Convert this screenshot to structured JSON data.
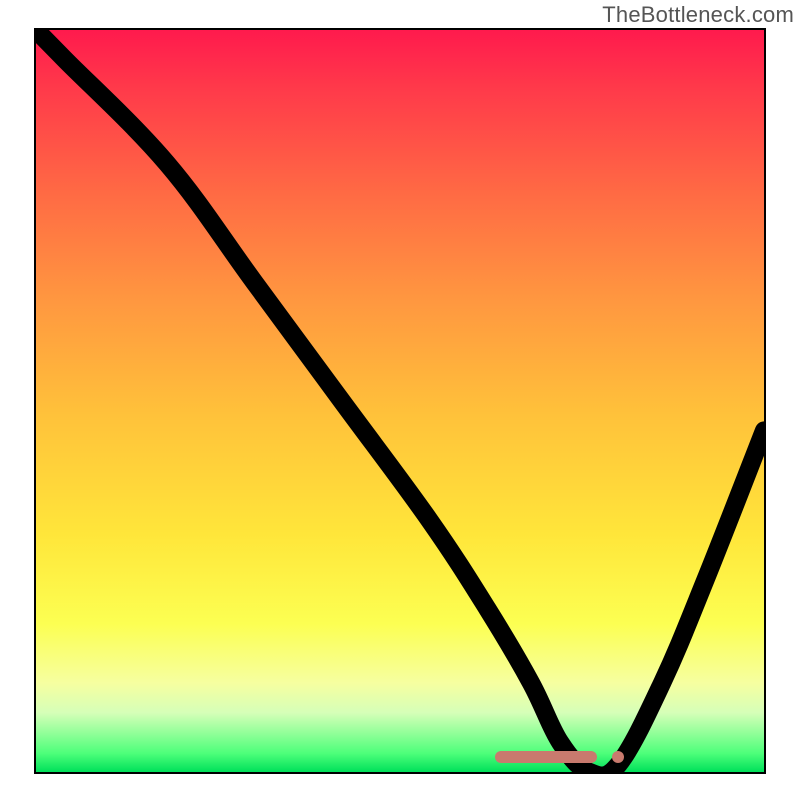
{
  "attribution": "TheBottleneck.com",
  "chart_data": {
    "type": "line",
    "title": "",
    "xlabel": "",
    "ylabel": "",
    "xlim": [
      0,
      100
    ],
    "ylim": [
      0,
      100
    ],
    "grid": false,
    "legend": false,
    "background_gradient": {
      "orientation": "vertical",
      "stops": [
        {
          "pos": 0.0,
          "color": "#ff1a4d"
        },
        {
          "pos": 0.5,
          "color": "#ffd23a"
        },
        {
          "pos": 0.85,
          "color": "#f9ff6a"
        },
        {
          "pos": 1.0,
          "color": "#00e05a"
        }
      ]
    },
    "series": [
      {
        "name": "bottleneck-curve",
        "x": [
          0,
          4,
          18,
          30,
          42,
          54,
          62,
          68,
          72,
          76,
          80,
          86,
          92,
          100
        ],
        "y": [
          100,
          96,
          82,
          66,
          50,
          34,
          22,
          12,
          4,
          0,
          1,
          12,
          26,
          46
        ]
      }
    ],
    "annotations": [
      {
        "name": "optimal-range-marker",
        "type": "bar",
        "x_start": 63,
        "x_end": 77,
        "y": 2,
        "color": "#c97a6e"
      },
      {
        "name": "optimal-point-marker",
        "type": "dot",
        "x": 80,
        "y": 2,
        "color": "#c97a6e"
      }
    ]
  }
}
